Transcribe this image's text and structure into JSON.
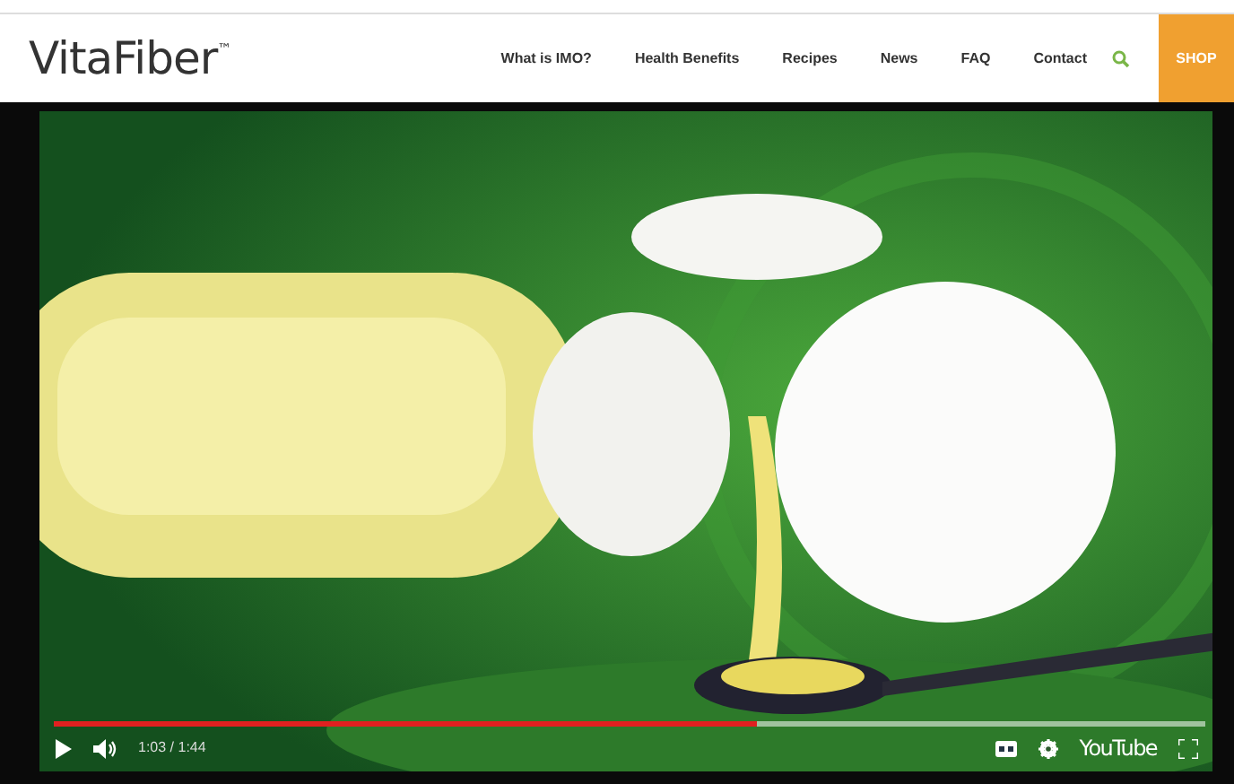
{
  "logo": {
    "name": "VitaFiber",
    "mark": "™"
  },
  "nav": [
    {
      "label": "What is IMO?"
    },
    {
      "label": "Health Benefits"
    },
    {
      "label": "Recipes"
    },
    {
      "label": "News"
    },
    {
      "label": "FAQ"
    },
    {
      "label": "Contact"
    }
  ],
  "shop": "SHOP",
  "player": {
    "progress": {
      "level": 0.61
    },
    "time": "1:03 / 1:44",
    "brand": "YouTube"
  }
}
